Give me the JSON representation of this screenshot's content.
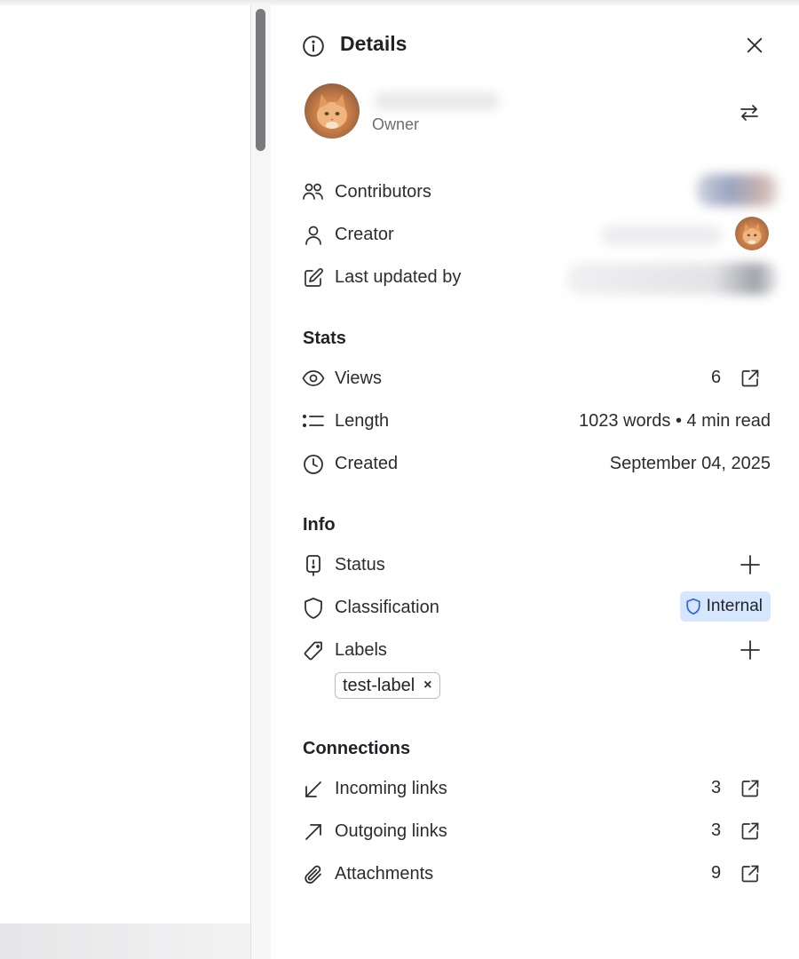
{
  "panel": {
    "title": "Details",
    "owner": {
      "role": "Owner",
      "name": ""
    },
    "people": {
      "contributors_label": "Contributors",
      "creator_label": "Creator",
      "last_updated_label": "Last updated by"
    },
    "stats": {
      "title": "Stats",
      "views_label": "Views",
      "views_value": "6",
      "length_label": "Length",
      "length_value": "1023 words • 4 min read",
      "created_label": "Created",
      "created_value": "September 04, 2025"
    },
    "info": {
      "title": "Info",
      "status_label": "Status",
      "classification_label": "Classification",
      "classification_value": "Internal",
      "labels_label": "Labels",
      "label_chips": [
        "test-label"
      ],
      "chip_remove_glyph": "×"
    },
    "connections": {
      "title": "Connections",
      "incoming_label": "Incoming links",
      "incoming_value": "3",
      "outgoing_label": "Outgoing links",
      "outgoing_value": "3",
      "attachments_label": "Attachments",
      "attachments_value": "9"
    }
  },
  "colors": {
    "badge_bg": "#d6e6ff",
    "badge_icon": "#2b63d9",
    "scrollbar_thumb": "#7a7a7e"
  },
  "icons": [
    "info-icon",
    "close-icon",
    "swap-icon",
    "contributors-icon",
    "user-icon",
    "edit-icon",
    "eye-icon",
    "list-icon",
    "clock-icon",
    "status-icon",
    "shield-icon",
    "tag-icon",
    "plus-icon",
    "arrow-down-left-icon",
    "arrow-up-right-icon",
    "paperclip-icon",
    "external-link-icon"
  ]
}
